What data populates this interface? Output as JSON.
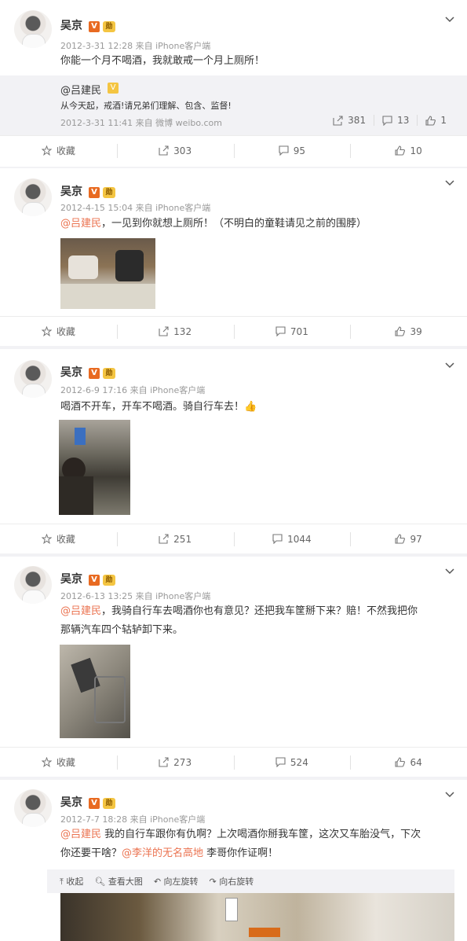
{
  "posts": [
    {
      "name": "吴京",
      "meta": "2012-3-31 12:28 来自 iPhone客户端",
      "text": "你能一个月不喝酒，我就敢戒一个月上厕所！",
      "repost": {
        "name": "@吕建民",
        "text": "从今天起，戒酒!请兄弟们理解、包含、监督!",
        "meta": "2012-3-31 11:41 来自 微博 weibo.com",
        "share_count": "381",
        "comment_count": "13",
        "like_count": "1"
      },
      "actions": {
        "fav": "收藏",
        "share": "303",
        "comment": "95",
        "like": "10"
      }
    },
    {
      "name": "吴京",
      "meta": "2012-4-15 15:04 来自 iPhone客户端",
      "mention": "@吕建民",
      "text": "，一见到你就想上厕所！（不明白的童鞋请见之前的围脖）",
      "actions": {
        "fav": "收藏",
        "share": "132",
        "comment": "701",
        "like": "39"
      }
    },
    {
      "name": "吴京",
      "meta": "2012-6-9 17:16 来自 iPhone客户端",
      "text": "喝酒不开车，开车不喝酒。骑自行车去！👍",
      "actions": {
        "fav": "收藏",
        "share": "251",
        "comment": "1044",
        "like": "97"
      }
    },
    {
      "name": "吴京",
      "meta": "2012-6-13 13:25 来自 iPhone客户端",
      "mention": "@吕建民",
      "text_line1": "，我骑自行车去喝酒你也有意见？还把我车筐掰下来？赔！不然我把你",
      "text_line2": "那辆汽车四个轱轳卸下来。",
      "actions": {
        "fav": "收藏",
        "share": "273",
        "comment": "524",
        "like": "64"
      }
    },
    {
      "name": "吴京",
      "meta": "2012-7-7 18:28 来自 iPhone客户端",
      "mention": "@吕建民",
      "text_a": " 我的自行车跟你有仇啊？上次喝酒你掰我车筐，这次又车胎没气，下次",
      "text_b": "你还要干啥？",
      "mention2": "@李洋的无名高地",
      "text_c": " 李哥你作证啊！",
      "toolbar": {
        "collapse": "收起",
        "view_large": "查看大图",
        "rotate_left": "向左旋转",
        "rotate_right": "向右旋转"
      }
    }
  ],
  "badges": {
    "v": "V",
    "medal": "勋"
  }
}
